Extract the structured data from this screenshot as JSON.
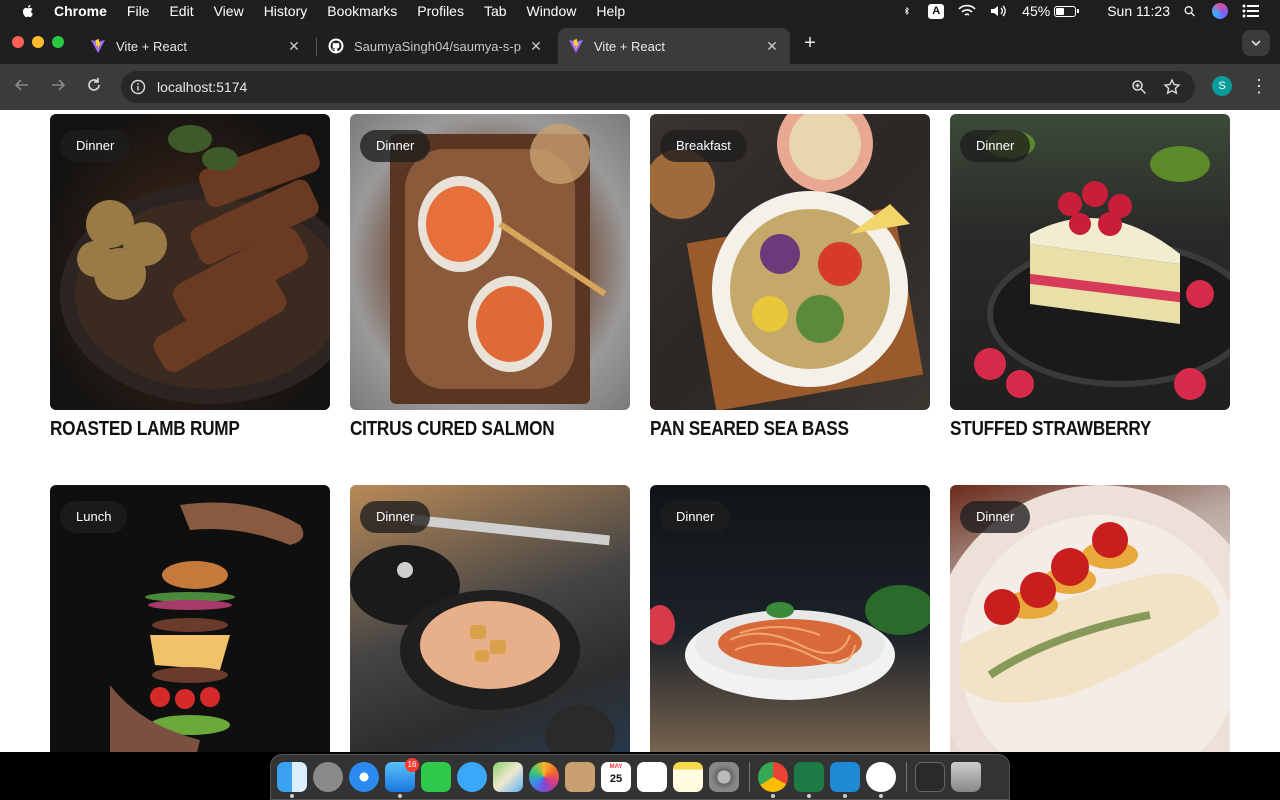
{
  "menubar": {
    "app_name": "Chrome",
    "items": [
      "File",
      "Edit",
      "View",
      "History",
      "Bookmarks",
      "Profiles",
      "Tab",
      "Window",
      "Help"
    ],
    "battery_percent": "45%",
    "battery_level": 0.45,
    "clock": "Sun 11:23",
    "input_source": "A"
  },
  "browser": {
    "tabs": [
      {
        "title": "Vite + React",
        "icon": "vite-icon",
        "active": false
      },
      {
        "title": "SaumyaSingh04/saumya-s-p",
        "icon": "github-icon",
        "active": false
      },
      {
        "title": "Vite + React",
        "icon": "vite-icon",
        "active": true
      }
    ],
    "url": "localhost:5174",
    "profile_initial": "S"
  },
  "recipes": [
    {
      "category": "Dinner",
      "name": "ROASTED LAMB RUMP"
    },
    {
      "category": "Dinner",
      "name": "CITRUS CURED SALMON"
    },
    {
      "category": "Breakfast",
      "name": "PAN SEARED SEA BASS"
    },
    {
      "category": "Dinner",
      "name": "STUFFED STRAWBERRY"
    },
    {
      "category": "Lunch",
      "name": ""
    },
    {
      "category": "Dinner",
      "name": ""
    },
    {
      "category": "Dinner",
      "name": ""
    },
    {
      "category": "Dinner",
      "name": ""
    }
  ],
  "dock": {
    "apps": [
      "Finder",
      "Launchpad",
      "Safari",
      "Mail",
      "FaceTime",
      "Messages",
      "Maps",
      "Photos",
      "Contacts",
      "Calendar",
      "Reminders",
      "Notes",
      "System Preferences",
      "Google Chrome",
      "Microsoft Excel",
      "Visual Studio Code",
      "MongoDB Compass",
      "Terminal",
      "Trash"
    ],
    "mail_badge": "16",
    "calendar_month": "MAY",
    "calendar_day": "25"
  }
}
